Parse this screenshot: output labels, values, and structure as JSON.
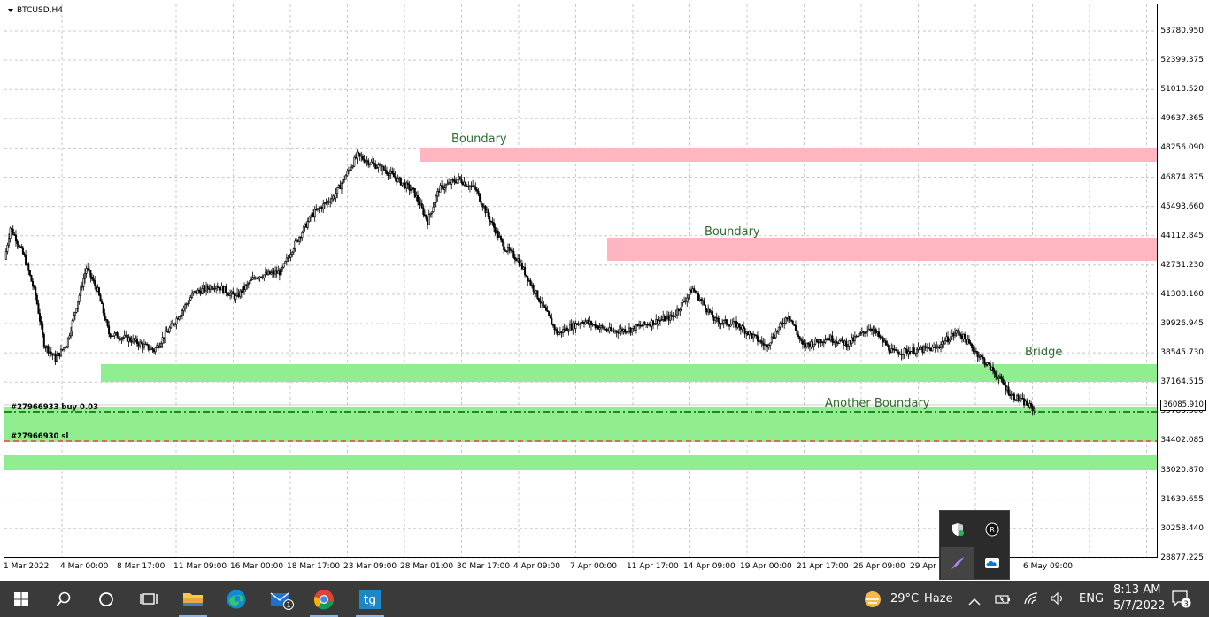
{
  "chart": {
    "symbol": "BTCUSD,H4",
    "price_labels": [
      "53780.950",
      "52399.375",
      "51018.520",
      "49637.365",
      "48256.090",
      "46874.875",
      "45493.660",
      "44112.845",
      "42731.230",
      "41308.160",
      "39926.945",
      "38545.730",
      "37164.515",
      "35783.300",
      "34402.085",
      "33020.870",
      "31639.655",
      "30258.440",
      "28877.225"
    ],
    "current_price": "36085.910",
    "time_labels": [
      "1 Mar 2022",
      "4 Mar 00:00",
      "8 Mar 17:00",
      "11 Mar 09:00",
      "16 Mar 00:00",
      "18 Mar 17:00",
      "23 Mar 09:00",
      "28 Mar 01:00",
      "30 Mar 17:00",
      "4 Apr 09:00",
      "7 Apr 00:00",
      "11 Apr 17:00",
      "14 Apr 09:00",
      "19 Apr 00:00",
      "21 Apr 17:00",
      "26 Apr 09:00",
      "29 Apr",
      "6 May 09:00"
    ],
    "annotations": {
      "boundary_top": "Boundary",
      "boundary_mid": "Boundary",
      "bridge": "Bridge",
      "another_boundary": "Another Boundary"
    },
    "orders": {
      "buy": "#27966933 buy 0.03",
      "sl": "#27966930 sl"
    },
    "colors": {
      "resistance_zone": "#ffb6c1",
      "support_zone": "#90ee90",
      "candle": "#000000",
      "grid": "#c8c8c8",
      "order_line": "#006400",
      "sl_line": "#ff0000"
    }
  },
  "taskbar": {
    "weather_temp": "29°C",
    "weather_desc": "Haze",
    "language": "ENG",
    "time": "8:13 AM",
    "date": "5/7/2022",
    "mail_badge": "1",
    "notification_count": "3",
    "icons": [
      "windows-start-icon",
      "search-icon",
      "cortana-icon",
      "task-view-icon",
      "file-explorer-icon",
      "edge-icon",
      "mail-icon",
      "chrome-icon",
      "tradingview-icon"
    ]
  },
  "tray_popup": {
    "icons": [
      "defender-shield-icon",
      "app-badge-icon",
      "feather-icon",
      "onedrive-cloud-icon"
    ]
  }
}
